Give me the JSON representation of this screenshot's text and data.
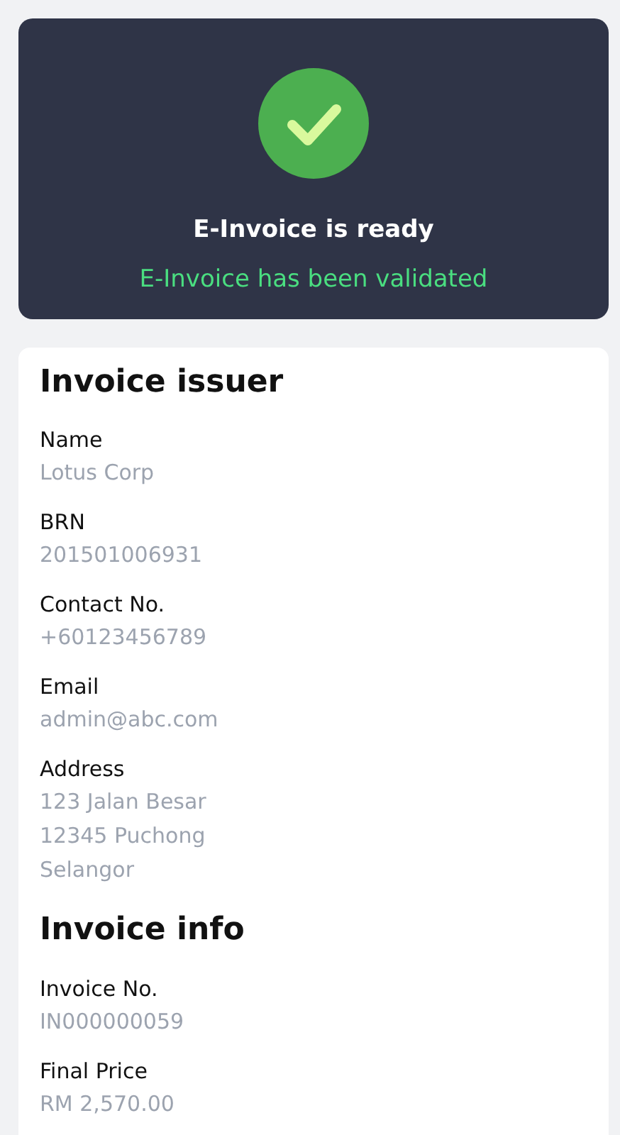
{
  "status_card": {
    "kind": "success",
    "title": "E-Invoice is ready",
    "message": "E-Invoice has been validated"
  },
  "sections": [
    {
      "title": "Invoice issuer",
      "fields": [
        {
          "label": "Name",
          "lines": [
            "Lotus Corp"
          ]
        },
        {
          "label": "BRN",
          "lines": [
            "201501006931"
          ]
        },
        {
          "label": "Contact No.",
          "lines": [
            "+60123456789"
          ]
        },
        {
          "label": "Email",
          "lines": [
            "admin@abc.com"
          ]
        },
        {
          "label": "Address",
          "lines": [
            "123 Jalan Besar",
            "12345 Puchong",
            "Selangor"
          ]
        }
      ]
    },
    {
      "title": "Invoice info",
      "fields": [
        {
          "label": "Invoice No.",
          "lines": [
            "IN000000059"
          ]
        },
        {
          "label": "Final Price",
          "lines": [
            "RM 2,570.00"
          ]
        }
      ]
    }
  ]
}
